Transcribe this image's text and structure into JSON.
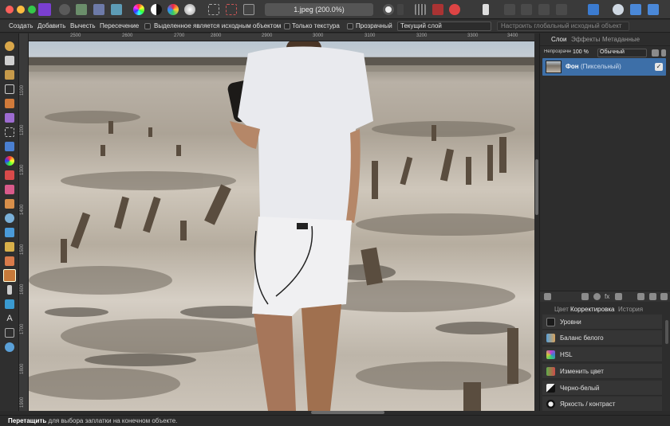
{
  "window": {
    "title": "1.jpeg (200.0%)"
  },
  "context_toolbar": {
    "create": "Создать",
    "add": "Добавить",
    "subtract": "Вычесть",
    "intersect": "Пересечение",
    "selected_is_source": "Выделенное является исходным объектом",
    "texture_only": "Только текстура",
    "transparent": "Прозрачный",
    "current_layer": "Текущий слой",
    "global_source": "Настроить глобальный исходный объект"
  },
  "ruler": {
    "top": [
      "2500",
      "2600",
      "2700",
      "2800",
      "2900",
      "3000",
      "3100",
      "3200",
      "3300",
      "3400"
    ],
    "left": [
      "1100",
      "1200",
      "1300",
      "1400",
      "1500",
      "1600",
      "1700",
      "1800",
      "1900"
    ]
  },
  "panels": {
    "top_tabs": [
      "Слои",
      "Эффекты",
      "Метаданные"
    ],
    "opacity_label": "Непрозрачность",
    "opacity_value": "100 %",
    "blend_mode": "Обычный",
    "layer": {
      "name": "Фон",
      "type": "(Пиксельный)"
    },
    "bottom_tabs": [
      "Цвет",
      "Корректировка",
      "История"
    ],
    "adjustments": [
      {
        "label": "Уровни",
        "color": "#1b1b1b"
      },
      {
        "label": "Баланс белого",
        "color": "#d8a25a"
      },
      {
        "label": "HSL",
        "color": "#c63ad0"
      },
      {
        "label": "Изменить цвет",
        "color": "#5fae4a"
      },
      {
        "label": "Черно-белый",
        "color": "#f2f2f2"
      },
      {
        "label": "Яркость / контраст",
        "color": "#111111"
      }
    ]
  },
  "status": {
    "bold": "Перетащить",
    "text": " для выбора заплатки на конечном объекте."
  }
}
